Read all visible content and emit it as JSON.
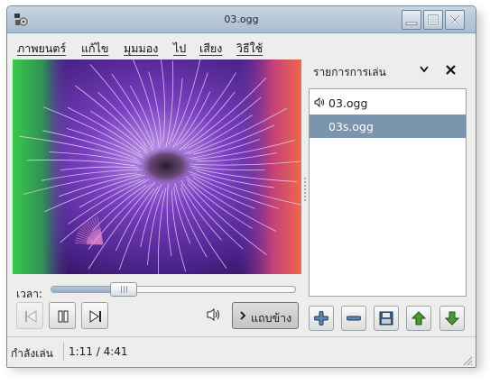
{
  "window": {
    "title": "03.ogg"
  },
  "menu": {
    "items": [
      {
        "label": "ภาพยนตร์"
      },
      {
        "label": "แก้ไข"
      },
      {
        "label": "มุมมอง"
      },
      {
        "label": "ไป"
      },
      {
        "label": "เสียง"
      },
      {
        "label": "วิธีใช้"
      }
    ]
  },
  "seek": {
    "label": "เวลา:",
    "position": 0.271
  },
  "controls": {
    "previous_icon": "skip-previous-icon",
    "pause_icon": "pause-icon",
    "next_icon": "skip-next-icon",
    "volume_icon": "speaker-icon",
    "sidebar_label": "แถบข้าง"
  },
  "sidebar": {
    "title": "รายการการเล่น",
    "items": [
      {
        "label": "03.ogg",
        "playing": true,
        "selected": false
      },
      {
        "label": "03s.ogg",
        "playing": false,
        "selected": true
      }
    ],
    "buttons": [
      "add-icon",
      "remove-icon",
      "save-icon",
      "move-up-icon",
      "move-down-icon"
    ]
  },
  "status": {
    "state": "กำลังเล่น",
    "time": "1:11  /  4:41"
  },
  "colors": {
    "selection": "#7a95ad",
    "titlebar": "#b7c8da",
    "accent_green": "#3f8a2f"
  }
}
